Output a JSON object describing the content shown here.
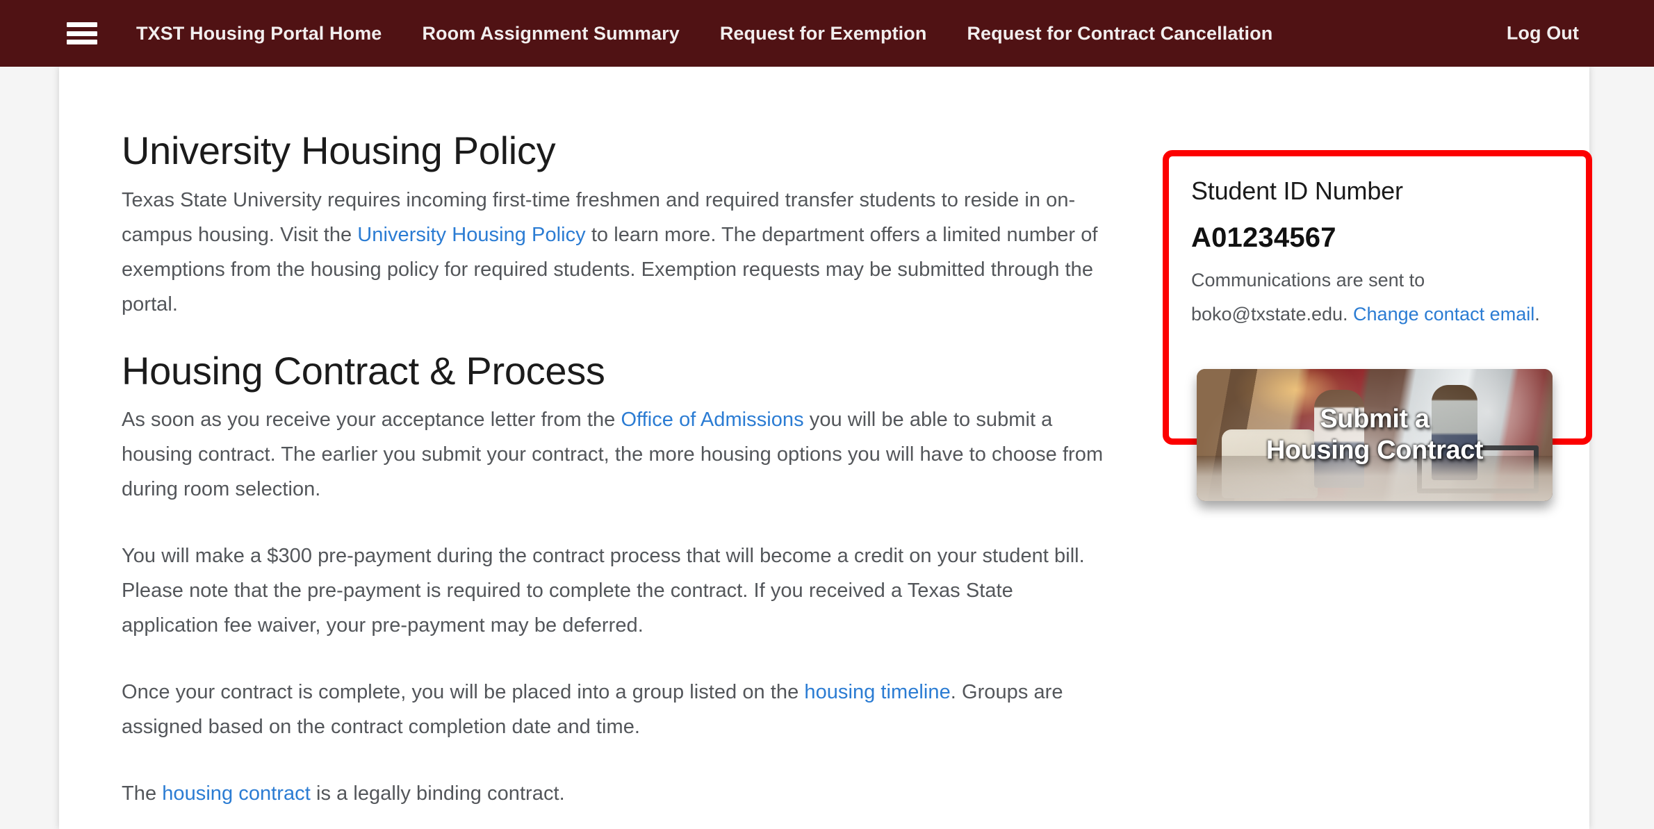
{
  "navbar": {
    "menu_icon": "hamburger-icon",
    "brand": "TXST Housing Portal Home",
    "items": [
      "Room Assignment Summary",
      "Request for Exemption",
      "Request for Contract Cancellation"
    ],
    "logout": "Log Out",
    "background_color": "#501214",
    "text_color": "#f2eeee"
  },
  "main": {
    "policy": {
      "heading": "University Housing Policy",
      "paragraph_part1": "Texas State University requires incoming first-time freshmen and required transfer students to reside in on-campus housing. Visit the ",
      "link_text": "University Housing Policy",
      "paragraph_part2": " to learn more. The department offers a limited number of exemptions from the housing policy for required students. Exemption requests may be submitted through the portal."
    },
    "contract": {
      "heading": "Housing Contract & Process",
      "p1_part1": "As soon as you receive your acceptance letter from the ",
      "p1_link": "Office of Admissions",
      "p1_part2": " you will be able to submit a housing contract. The earlier you submit your contract, the more housing options you will have to choose from during room selection.",
      "p2": "You will make a $300 pre-payment during the contract process that will become a credit on your student bill. Please note that the pre-payment is required to complete the contract. If you received a Texas State application fee waiver, your pre-payment may be deferred.",
      "p3_part1": "Once your contract is complete, you will be placed into a group listed on the ",
      "p3_link": "housing timeline",
      "p3_part2": ". Groups are assigned based on the contract completion date and time.",
      "p4_part1": "The ",
      "p4_link": "housing contract",
      "p4_part2": " is a legally binding contract."
    }
  },
  "sidebar": {
    "student_id_label": "Student ID Number",
    "student_id_value": "A01234567",
    "comm_part1": "Communications are sent to boko@txstate.edu. ",
    "comm_link": "Change contact email",
    "comm_part2": ".",
    "highlight_color": "#fc0000",
    "promo": {
      "line1": "Submit a",
      "line2": "Housing Contract"
    }
  },
  "theme": {
    "link_color": "#2b7cd3",
    "body_text_color": "#53565a",
    "heading_color": "#1b1b1b",
    "page_background": "#f5f5f5",
    "card_background": "#ffffff"
  }
}
